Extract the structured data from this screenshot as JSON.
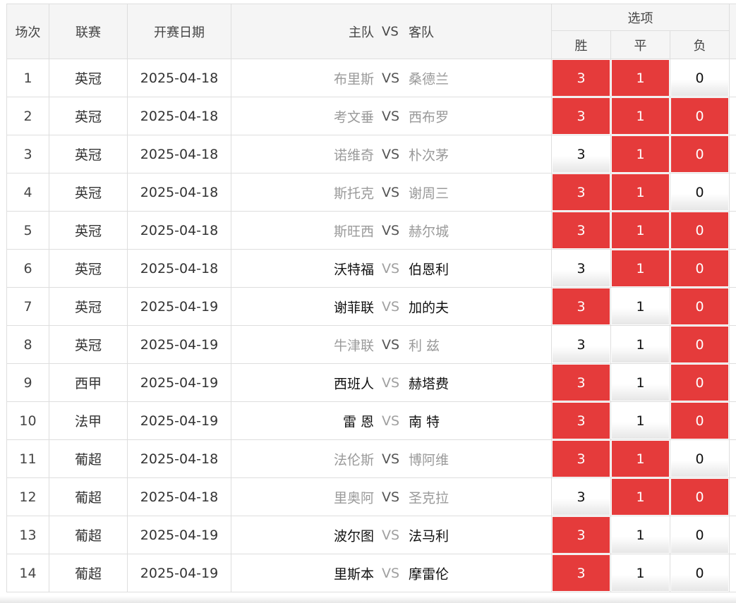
{
  "header": {
    "col_index": "场次",
    "col_league": "联赛",
    "col_date": "开赛日期",
    "col_match_home": "主队",
    "col_match_vs": "VS",
    "col_match_away": "客队",
    "col_options": "选项",
    "opt_win": "胜",
    "opt_draw": "平",
    "opt_lose": "负"
  },
  "colors": {
    "selected": "#e53b3b",
    "selected_text": "#ffffff",
    "unselected_text": "#111111"
  },
  "rows": [
    {
      "idx": "1",
      "league": "英冠",
      "date": "2025-04-18",
      "home": "布里斯",
      "vs": "VS",
      "away": "桑德兰",
      "style": "muted",
      "win": "3",
      "draw": "1",
      "lose": "0",
      "sel": [
        true,
        true,
        false
      ]
    },
    {
      "idx": "2",
      "league": "英冠",
      "date": "2025-04-18",
      "home": "考文垂",
      "vs": "VS",
      "away": "西布罗",
      "style": "muted",
      "win": "3",
      "draw": "1",
      "lose": "0",
      "sel": [
        true,
        true,
        true
      ]
    },
    {
      "idx": "3",
      "league": "英冠",
      "date": "2025-04-18",
      "home": "诺维奇",
      "vs": "VS",
      "away": "朴次茅",
      "style": "muted",
      "win": "3",
      "draw": "1",
      "lose": "0",
      "sel": [
        false,
        true,
        true
      ]
    },
    {
      "idx": "4",
      "league": "英冠",
      "date": "2025-04-18",
      "home": "斯托克",
      "vs": "VS",
      "away": "谢周三",
      "style": "muted",
      "win": "3",
      "draw": "1",
      "lose": "0",
      "sel": [
        true,
        true,
        false
      ]
    },
    {
      "idx": "5",
      "league": "英冠",
      "date": "2025-04-18",
      "home": "斯旺西",
      "vs": "VS",
      "away": "赫尔城",
      "style": "muted",
      "win": "3",
      "draw": "1",
      "lose": "0",
      "sel": [
        true,
        true,
        true
      ]
    },
    {
      "idx": "6",
      "league": "英冠",
      "date": "2025-04-18",
      "home": "沃特福",
      "vs": "VS",
      "away": "伯恩利",
      "style": "bold",
      "win": "3",
      "draw": "1",
      "lose": "0",
      "sel": [
        false,
        true,
        true
      ]
    },
    {
      "idx": "7",
      "league": "英冠",
      "date": "2025-04-19",
      "home": "谢菲联",
      "vs": "VS",
      "away": "加的夫",
      "style": "bold",
      "win": "3",
      "draw": "1",
      "lose": "0",
      "sel": [
        true,
        false,
        true
      ]
    },
    {
      "idx": "8",
      "league": "英冠",
      "date": "2025-04-19",
      "home": "牛津联",
      "vs": "VS",
      "away": "利 兹",
      "style": "muted",
      "win": "3",
      "draw": "1",
      "lose": "0",
      "sel": [
        false,
        false,
        true
      ]
    },
    {
      "idx": "9",
      "league": "西甲",
      "date": "2025-04-19",
      "home": "西班人",
      "vs": "VS",
      "away": "赫塔费",
      "style": "bold",
      "win": "3",
      "draw": "1",
      "lose": "0",
      "sel": [
        true,
        false,
        true
      ]
    },
    {
      "idx": "10",
      "league": "法甲",
      "date": "2025-04-19",
      "home": "雷 恩",
      "vs": "VS",
      "away": "南 特",
      "style": "bold",
      "win": "3",
      "draw": "1",
      "lose": "0",
      "sel": [
        true,
        false,
        true
      ]
    },
    {
      "idx": "11",
      "league": "葡超",
      "date": "2025-04-18",
      "home": "法伦斯",
      "vs": "VS",
      "away": "博阿维",
      "style": "muted",
      "win": "3",
      "draw": "1",
      "lose": "0",
      "sel": [
        true,
        true,
        false
      ]
    },
    {
      "idx": "12",
      "league": "葡超",
      "date": "2025-04-18",
      "home": "里奥阿",
      "vs": "VS",
      "away": "圣克拉",
      "style": "muted",
      "win": "3",
      "draw": "1",
      "lose": "0",
      "sel": [
        false,
        true,
        true
      ]
    },
    {
      "idx": "13",
      "league": "葡超",
      "date": "2025-04-19",
      "home": "波尔图",
      "vs": "VS",
      "away": "法马利",
      "style": "bold",
      "win": "3",
      "draw": "1",
      "lose": "0",
      "sel": [
        true,
        false,
        false
      ]
    },
    {
      "idx": "14",
      "league": "葡超",
      "date": "2025-04-19",
      "home": "里斯本",
      "vs": "VS",
      "away": "摩雷伦",
      "style": "bold",
      "win": "3",
      "draw": "1",
      "lose": "0",
      "sel": [
        true,
        false,
        false
      ]
    }
  ]
}
